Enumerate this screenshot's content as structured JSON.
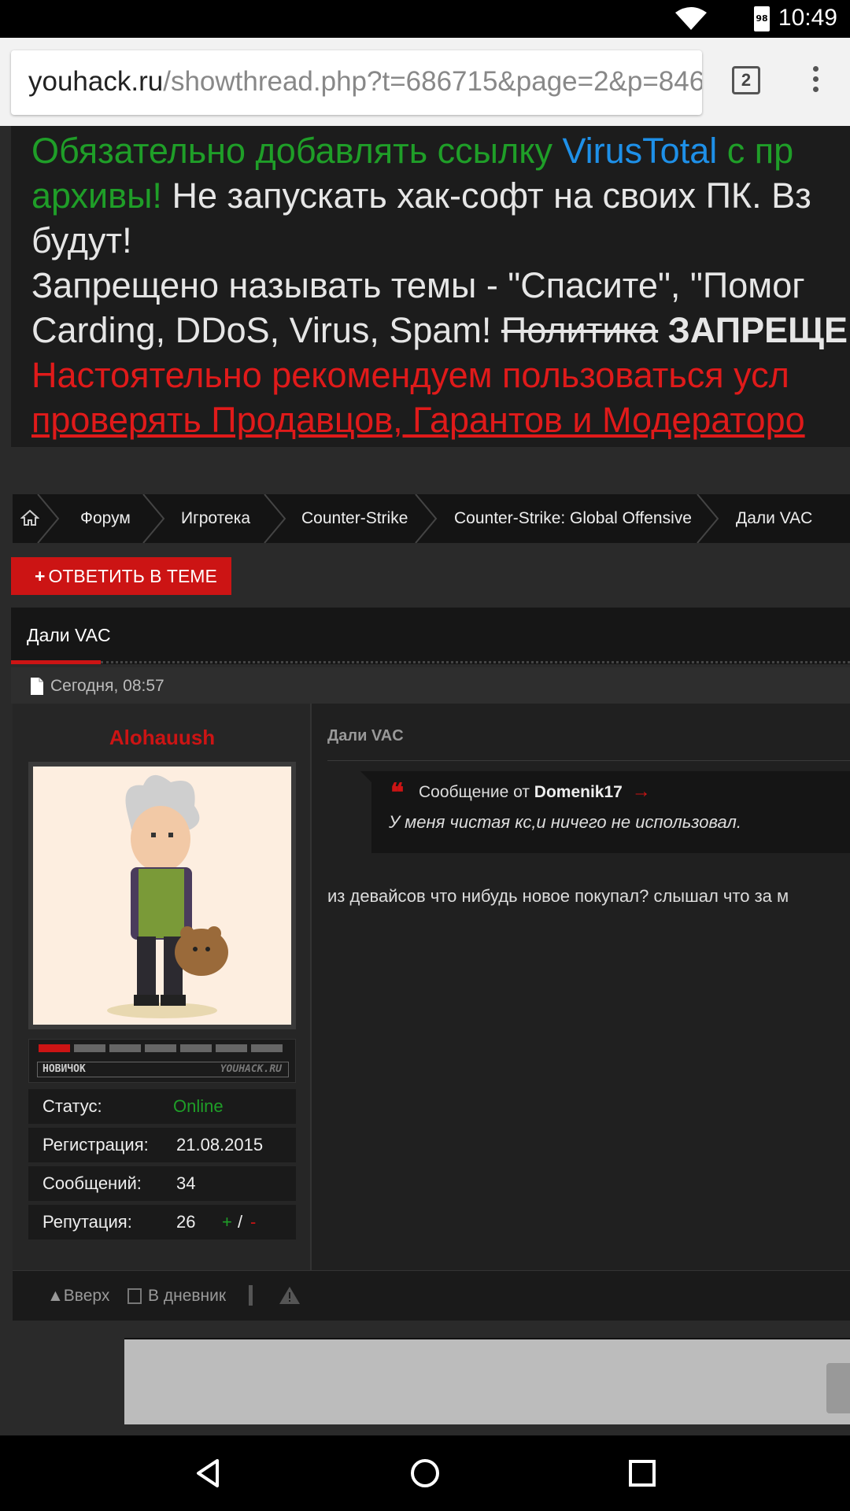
{
  "statusbar": {
    "time": "10:49",
    "battery_level": "98",
    "wifi_icon": "wifi-icon",
    "battery_icon": "battery-icon"
  },
  "browser": {
    "url_host": "youhack.ru",
    "url_path": "/showthread.php?t=686715&page=2&p=846",
    "tab_count": "2"
  },
  "notice": {
    "line1_green": "Обязательно добавлять ссылку ",
    "line1_blue": "VirusTotal",
    "line1_green2": " с пр",
    "line2_green": "архивы!",
    "line2_white": " Не запускать хак-софт на своих ПК. Вз",
    "line3_white": "будут!",
    "line4_white": "Запрещено называть темы - \"Спасите\", \"Помог",
    "line5_white": "Carding, DDoS, Virus, Spam! ",
    "line5_strike": "Политика",
    "line5_bold": " ЗАПРЕЩЕ",
    "line6_red": "Настоятельно рекомендуем пользоваться усл",
    "line7_red": "проверять Продавцов, Гарантов и Модераторо"
  },
  "breadcrumbs": {
    "home_icon": "home-icon",
    "items": [
      "Форум",
      "Игротека",
      "Counter-Strike",
      "Counter-Strike: Global Offensive",
      "Дали VAC"
    ]
  },
  "reply_button": {
    "plus": "+",
    "label": "ОТВЕТИТЬ В ТЕМЕ"
  },
  "thread": {
    "title": "Дали VAC"
  },
  "post": {
    "date": "Сегодня, 08:57",
    "username": "Alohauush",
    "rank_label": "НОВИЧОК",
    "rank_site": "YOUHACK.RU",
    "rank_level": 1,
    "rank_max": 7,
    "info": [
      {
        "key": "Статус:",
        "value": "Online"
      },
      {
        "key": "Регистрация:",
        "value": "21.08.2015"
      },
      {
        "key": "Сообщений:",
        "value": "34"
      },
      {
        "key": "Репутация:",
        "value": "26"
      }
    ],
    "rep_plus": "+",
    "rep_slash": "/",
    "rep_minus": "-",
    "message_title": "Дали VAC",
    "quote": {
      "prefix": "Сообщение от ",
      "author": "Domenik17",
      "text": "У меня чистая кс,и ничего не использовал."
    },
    "body": "из девайсов что нибудь новое покупал? слышал что за м"
  },
  "footer": {
    "top_label": "Вверх",
    "diary_label": "В дневник"
  },
  "colors": {
    "accent_red": "#cc1414",
    "online_green": "#1f9e28",
    "link_blue": "#1e90e8"
  }
}
